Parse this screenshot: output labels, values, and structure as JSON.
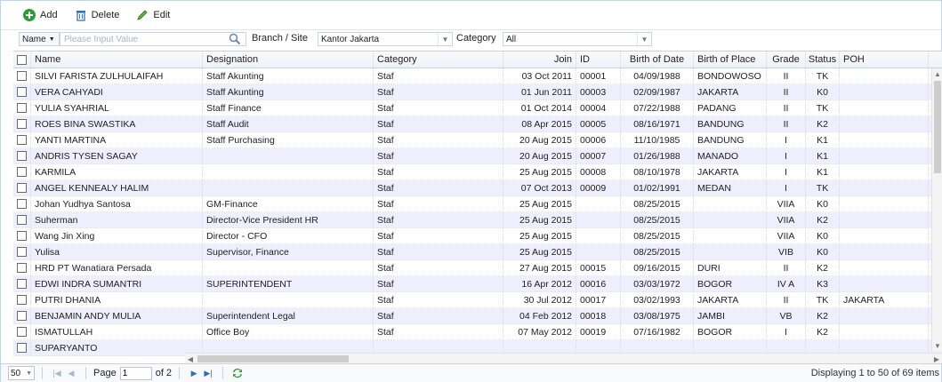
{
  "toolbar": {
    "add_label": "Add",
    "delete_label": "Delete",
    "edit_label": "Edit"
  },
  "filter": {
    "name_select": "Name",
    "search_placeholder": "Please Input Value",
    "branch_label": "Branch / Site",
    "branch_value": "Kantor Jakarta",
    "category_label": "Category",
    "category_value": "All"
  },
  "grid": {
    "columns": [
      "Name",
      "Designation",
      "Category",
      "Join",
      "ID",
      "Birth of Date",
      "Birth of Place",
      "Grade",
      "Status",
      "POH"
    ],
    "rows": [
      [
        "SILVI FARISTA ZULHULAIFAH",
        "Staff Akunting",
        "Staf",
        "03 Oct 2011",
        "00001",
        "04/09/1988",
        "BONDOWOSO",
        "II",
        "TK",
        ""
      ],
      [
        "VERA CAHYADI",
        "Staff Akunting",
        "Staf",
        "01 Jun 2011",
        "00003",
        "02/09/1987",
        "JAKARTA",
        "II",
        "K0",
        ""
      ],
      [
        "YULIA SYAHRIAL",
        "Staff Finance",
        "Staf",
        "01 Oct 2014",
        "00004",
        "07/22/1988",
        "PADANG",
        "II",
        "TK",
        ""
      ],
      [
        "ROES BINA SWASTIKA",
        "Staff Audit",
        "Staf",
        "08 Apr 2015",
        "00005",
        "08/16/1971",
        "BANDUNG",
        "II",
        "K2",
        ""
      ],
      [
        "YANTI MARTINA",
        "Staff Purchasing",
        "Staf",
        "20 Aug 2015",
        "00006",
        "11/10/1985",
        "BANDUNG",
        "I",
        "K1",
        ""
      ],
      [
        "ANDRIS TYSEN SAGAY",
        "",
        "Staf",
        "20 Aug 2015",
        "00007",
        "01/26/1988",
        "MANADO",
        "I",
        "K1",
        ""
      ],
      [
        "KARMILA",
        "",
        "Staf",
        "25 Aug 2015",
        "00008",
        "08/10/1978",
        "JAKARTA",
        "I",
        "K1",
        ""
      ],
      [
        "ANGEL KENNEALY HALIM",
        "",
        "Staf",
        "07 Oct 2013",
        "00009",
        "01/02/1991",
        "MEDAN",
        "I",
        "TK",
        ""
      ],
      [
        "Johan Yudhya Santosa",
        "GM-Finance",
        "Staf",
        "25 Aug 2015",
        "",
        "08/25/2015",
        "",
        "VIIA",
        "K0",
        ""
      ],
      [
        "Suherman",
        "Director-Vice President HR",
        "Staf",
        "25 Aug 2015",
        "",
        "08/25/2015",
        "",
        "VIIA",
        "K2",
        ""
      ],
      [
        "Wang Jin Xing",
        "Director - CFO",
        "Staf",
        "25 Aug 2015",
        "",
        "08/25/2015",
        "",
        "VIIA",
        "K0",
        ""
      ],
      [
        "Yulisa",
        "Supervisor, Finance",
        "Staf",
        "25 Aug 2015",
        "",
        "08/25/2015",
        "",
        "VIB",
        "K0",
        ""
      ],
      [
        "HRD PT Wanatiara Persada",
        "",
        "Staf",
        "27 Aug 2015",
        "00015",
        "09/16/2015",
        "DURI",
        "II",
        "K2",
        ""
      ],
      [
        "EDWI INDRA SUMANTRI",
        "SUPERINTENDENT",
        "Staf",
        "16 Apr 2012",
        "00016",
        "03/03/1972",
        "BOGOR",
        "IV A",
        "K3",
        ""
      ],
      [
        "PUTRI DHANIA",
        "",
        "Staf",
        "30 Jul 2012",
        "00017",
        "03/02/1993",
        "JAKARTA",
        "II",
        "TK",
        "JAKARTA"
      ],
      [
        "BENJAMIN ANDY MULIA",
        "Superintendent Legal",
        "Staf",
        "04 Feb 2012",
        "00018",
        "03/08/1975",
        "JAMBI",
        "VB",
        "K2",
        ""
      ],
      [
        "ISMATULLAH",
        "Office Boy",
        "Staf",
        "07 May 2012",
        "00019",
        "07/16/1982",
        "BOGOR",
        "I",
        "K2",
        ""
      ],
      [
        "SUPARYANTO",
        "",
        "",
        "",
        "",
        "",
        "",
        "",
        "",
        ""
      ]
    ]
  },
  "pager": {
    "page_size": "50",
    "page_label": "Page",
    "page_value": "1",
    "of_label": "of 2",
    "display_text": "Displaying 1 to 50 of 69 items"
  },
  "colors": {
    "accent": "#2f6db5",
    "alt_row": "#eeeefc",
    "border": "#c5d3e6"
  },
  "icons": [
    "add-icon",
    "delete-icon",
    "edit-icon",
    "search-icon",
    "dropdown-icon",
    "first-page-icon",
    "prev-page-icon",
    "next-page-icon",
    "last-page-icon",
    "refresh-icon"
  ]
}
